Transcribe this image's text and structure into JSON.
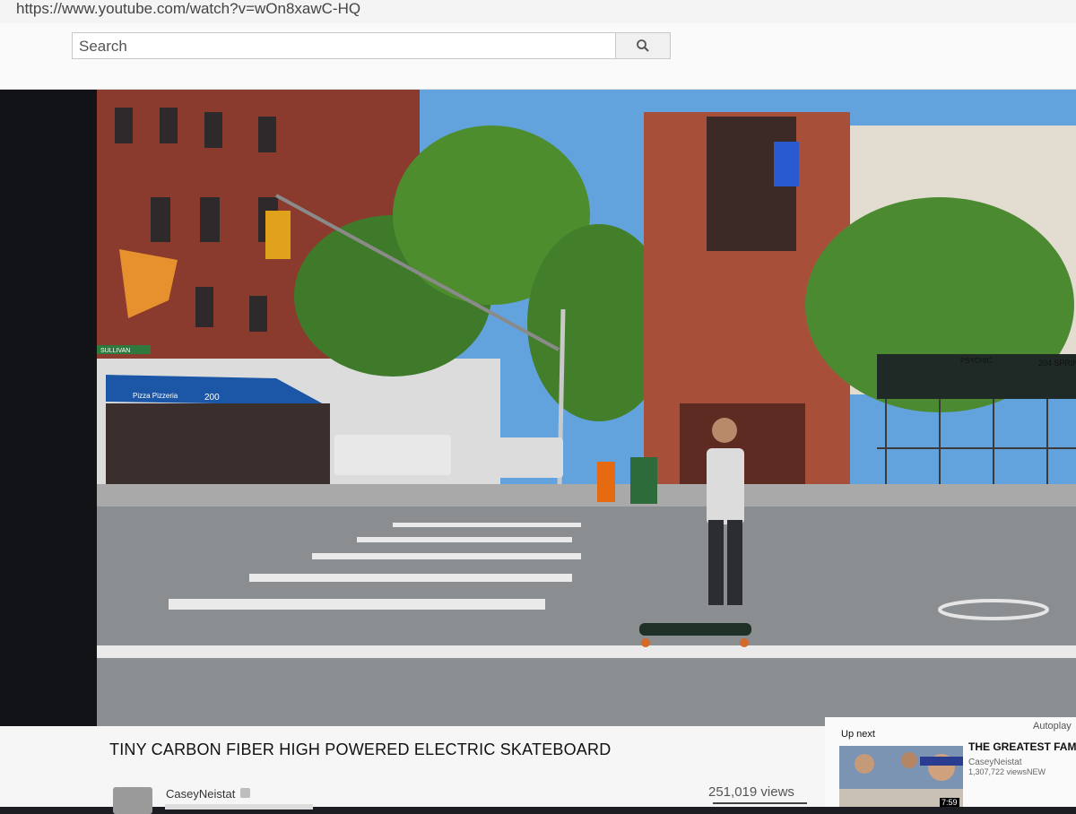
{
  "browser": {
    "url": "https://www.youtube.com/watch?v=wOn8xawC-HQ"
  },
  "search": {
    "placeholder": "Search"
  },
  "video": {
    "title": "TINY CARBON FIBER HIGH POWERED ELECTRIC SKATEBOARD",
    "views": "251,019 views"
  },
  "channel": {
    "name": "CaseyNeistat"
  },
  "scene_text": {
    "awning_number": "200",
    "awning_sign": "Pizza  Pizzeria",
    "corner_sign_1": "204 SPRIN",
    "corner_sign_2": "PSYCHIC",
    "street_sign": "SULLIVAN"
  },
  "sidebar": {
    "up_next_label": "Up next",
    "autoplay_label": "Autoplay",
    "recommended": {
      "title": "THE GREATEST FAMILY",
      "channel": "CaseyNeistat",
      "views": "1,307,722 views",
      "badge": "NEW",
      "duration": "7:59"
    }
  }
}
